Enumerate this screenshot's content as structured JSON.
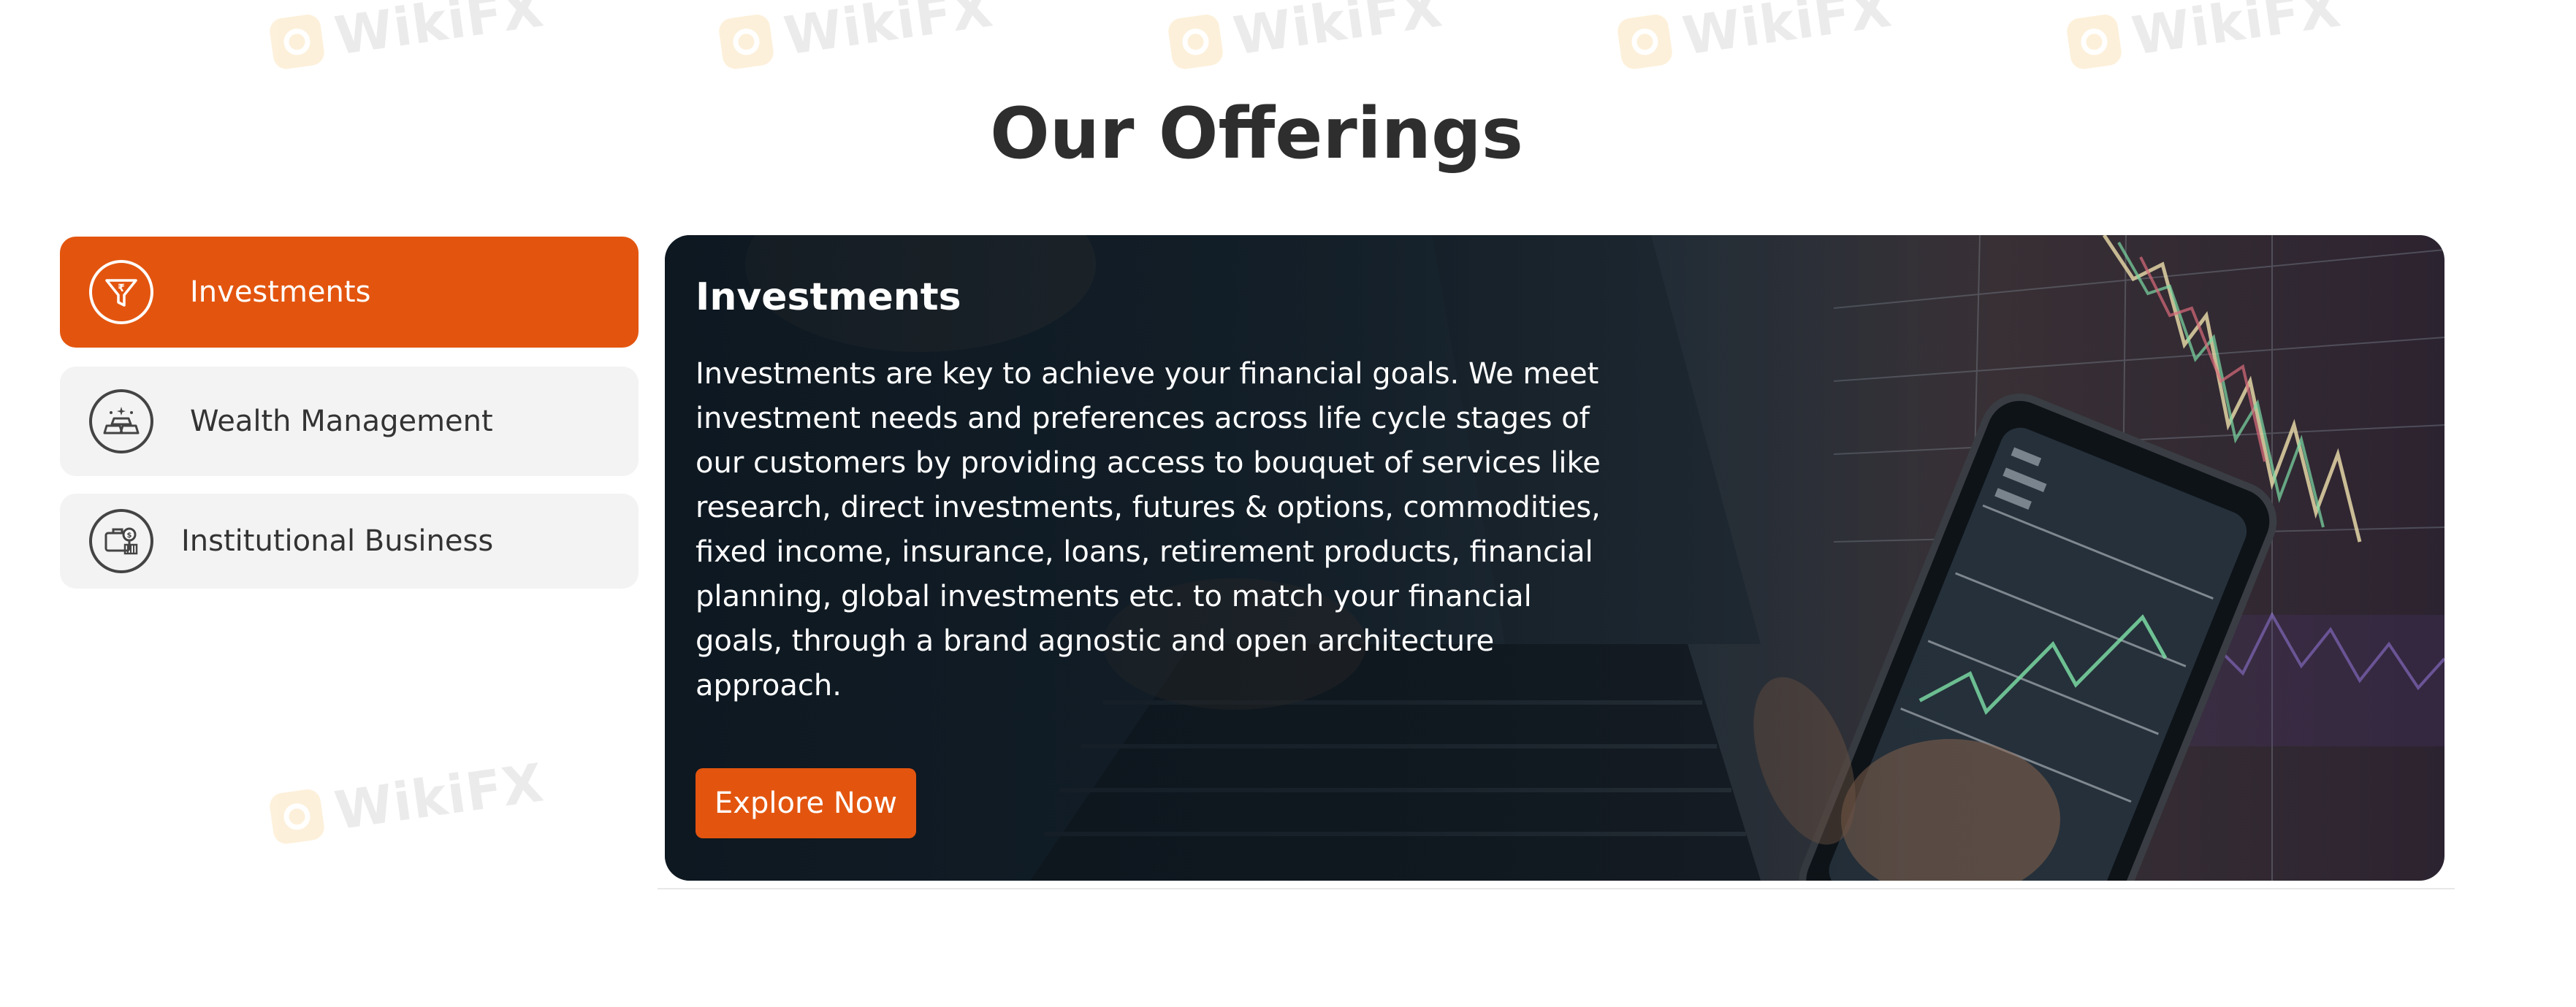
{
  "section": {
    "title": "Our Offerings"
  },
  "tabs": [
    {
      "label": "Investments",
      "icon": "rupee-funnel-icon",
      "active": true
    },
    {
      "label": "Wealth Management",
      "icon": "gold-bars-icon",
      "active": false
    },
    {
      "label": "Institutional Business",
      "icon": "briefcase-money-icon",
      "active": false
    }
  ],
  "feature": {
    "heading": "Investments",
    "description": "Investments are key to achieve your financial goals. We meet investment needs and preferences across life cycle stages of our customers by providing access to bouquet of services like research, direct investments, futures & options, commodities, fixed income, insurance, loans, retirement products, financial planning, global investments etc. to match your financial goals, through a brand agnostic and open architecture approach.",
    "cta_label": "Explore Now",
    "background_image": "trading-laptop-phone-image"
  },
  "watermark": {
    "text": "WikiFX"
  },
  "colors": {
    "accent": "#e3550f",
    "tab_inactive_bg": "#f3f3f3",
    "title_text": "#2e2e2e"
  }
}
